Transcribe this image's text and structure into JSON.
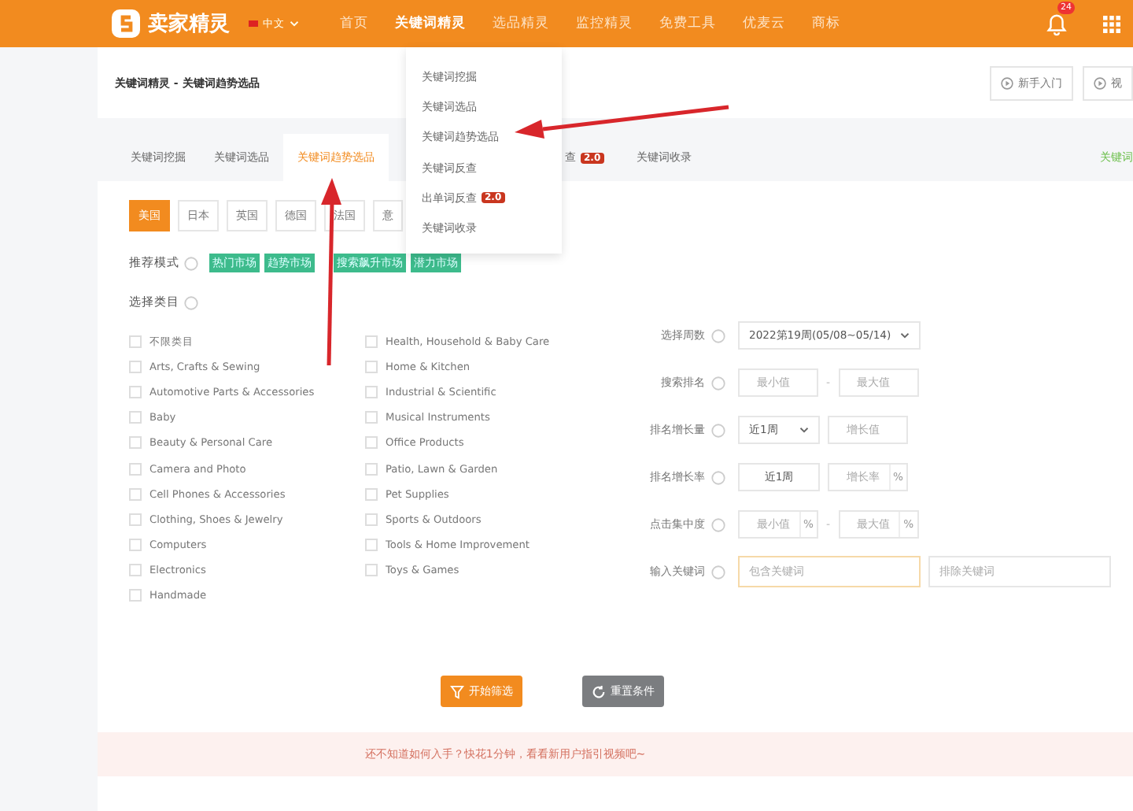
{
  "header": {
    "logo": "卖家精灵",
    "language": "中文",
    "nav": [
      {
        "label": "首页",
        "selected": false
      },
      {
        "label": "关键词精灵",
        "selected": true
      },
      {
        "label": "选品精灵",
        "selected": false
      },
      {
        "label": "监控精灵",
        "selected": false
      },
      {
        "label": "免费工具",
        "selected": false
      },
      {
        "label": "优麦云",
        "selected": false
      },
      {
        "label": "商标",
        "selected": false
      }
    ],
    "notification_count": "24"
  },
  "breadcrumb": "关键词精灵 - 关键词趋势选品",
  "header_buttons": [
    "新手入门",
    "视"
  ],
  "tabs": [
    {
      "label": "关键词挖掘",
      "selected": false
    },
    {
      "label": "关键词选品",
      "selected": false
    },
    {
      "label": "关键词趋势选品",
      "selected": true
    },
    {
      "label": "查",
      "selected": false,
      "badge": "2.0"
    },
    {
      "label": "关键词收录",
      "selected": false
    }
  ],
  "tab_right": "关键词",
  "dropdown": [
    {
      "label": "关键词挖掘"
    },
    {
      "label": "关键词选品"
    },
    {
      "label": "关键词趋势选品"
    },
    {
      "label": "关键词反查"
    },
    {
      "label": "出单词反查",
      "badge": "2.0"
    },
    {
      "label": "关键词收录"
    }
  ],
  "markets": [
    {
      "label": "美国",
      "selected": true
    },
    {
      "label": "日本",
      "selected": false
    },
    {
      "label": "英国",
      "selected": false
    },
    {
      "label": "德国",
      "selected": false
    },
    {
      "label": "法国",
      "selected": false
    },
    {
      "label": "意",
      "selected": false
    }
  ],
  "recommend": {
    "label": "推荐模式",
    "tags": [
      "热门市场",
      "趋势市场",
      "搜索飙升市场",
      "潜力市场"
    ]
  },
  "category_label": "选择类目",
  "categories": [
    [
      {
        "label": "不限类目",
        "checked": false
      },
      {
        "label": "Arts, Crafts & Sewing",
        "checked": false
      },
      {
        "label": "Automotive Parts & Accessories",
        "checked": false
      },
      {
        "label": "Baby",
        "checked": false
      },
      {
        "label": "Beauty & Personal Care",
        "checked": false
      },
      {
        "label": "Camera and Photo",
        "checked": false
      },
      {
        "label": "Cell Phones & Accessories",
        "checked": false
      },
      {
        "label": "Clothing, Shoes & Jewelry",
        "checked": false
      },
      {
        "label": "Computers",
        "checked": false
      },
      {
        "label": "Electronics",
        "checked": false
      },
      {
        "label": "Handmade",
        "checked": false
      }
    ],
    [
      {
        "label": "Health, Household & Baby Care",
        "checked": false
      },
      {
        "label": "Home & Kitchen",
        "checked": false
      },
      {
        "label": "Industrial & Scientific",
        "checked": false
      },
      {
        "label": "Musical Instruments",
        "checked": false
      },
      {
        "label": "Office Products",
        "checked": false
      },
      {
        "label": "Patio, Lawn & Garden",
        "checked": false
      },
      {
        "label": "Pet Supplies",
        "checked": false
      },
      {
        "label": "Sports & Outdoors",
        "checked": false
      },
      {
        "label": "Tools & Home Improvement",
        "checked": false
      },
      {
        "label": "Toys & Games",
        "checked": false
      }
    ]
  ],
  "filters": [
    {
      "kind": "select",
      "label": "选择周数",
      "value": "2022第19周(05/08~05/14)"
    },
    {
      "kind": "range",
      "label": "搜索排名",
      "min_placeholder": "最小值",
      "separator": "-",
      "max_placeholder": "最大值"
    },
    {
      "kind": "select_input",
      "label": "排名增长量",
      "value": "近1周",
      "placeholder": "增长值"
    },
    {
      "kind": "text_pct",
      "label": "排名增长率",
      "value": "近1周",
      "placeholder": "增长率",
      "suffix": "%"
    },
    {
      "kind": "range",
      "label": "点击集中度",
      "min_placeholder": "最小值",
      "separator": "-",
      "max_placeholder": "最大值",
      "suffix": "%"
    },
    {
      "kind": "keywords",
      "label": "输入关键词",
      "include_placeholder": "包含关键词",
      "exclude_placeholder": "排除关键词"
    }
  ],
  "actions": {
    "primary": "开始筛选",
    "reset": "重置条件"
  },
  "banner": "还不知道如何入手？快花1分钟，看看新用户指引视频吧~"
}
